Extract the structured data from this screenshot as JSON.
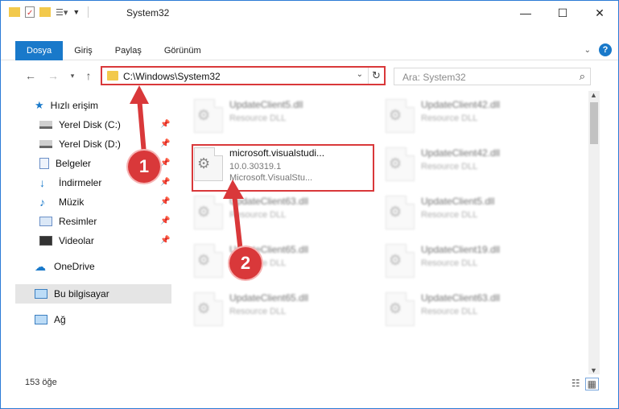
{
  "window": {
    "title": "System32",
    "controls": {
      "minimize": "—",
      "maximize": "☐",
      "close": "✕"
    }
  },
  "ribbon": {
    "tabs": [
      "Dosya",
      "Giriş",
      "Paylaş",
      "Görünüm"
    ],
    "active_tab": "Dosya",
    "help": "?"
  },
  "address": {
    "path": "C:\\Windows\\System32",
    "search_placeholder": "Ara: System32"
  },
  "nav": {
    "items": [
      {
        "label": "Hızlı erişim",
        "icon": "star-icon"
      },
      {
        "label": "Yerel Disk (C:)",
        "icon": "drive-icon",
        "pinned": true
      },
      {
        "label": "Yerel Disk (D:)",
        "icon": "drive-icon",
        "pinned": true
      },
      {
        "label": "Belgeler",
        "icon": "document-icon",
        "pinned": true
      },
      {
        "label": "İndirmeler",
        "icon": "download-icon",
        "pinned": true
      },
      {
        "label": "Müzik",
        "icon": "music-icon",
        "pinned": true
      },
      {
        "label": "Resimler",
        "icon": "pictures-icon",
        "pinned": true
      },
      {
        "label": "Videolar",
        "icon": "videos-icon",
        "pinned": true
      },
      {
        "label": "OneDrive",
        "icon": "cloud-icon"
      },
      {
        "label": "Bu bilgisayar",
        "icon": "computer-icon",
        "selected": true
      },
      {
        "label": "Ağ",
        "icon": "network-icon"
      }
    ]
  },
  "files": {
    "left": [
      {
        "name": "UpdateClient5.dll",
        "l1": "Resource DLL",
        "l2": ""
      },
      {
        "name": "microsoft.visualstudi...",
        "l1": "10.0.30319.1",
        "l2": "Microsoft.VisualStu..."
      },
      {
        "name": "UpdateClient63.dll",
        "l1": "Resource DLL",
        "l2": ""
      },
      {
        "name": "UpdateClient65.dll",
        "l1": "Resource DLL",
        "l2": ""
      },
      {
        "name": "UpdateClient65.dll",
        "l1": "Resource DLL",
        "l2": ""
      }
    ],
    "right": [
      {
        "name": "UpdateClient42.dll",
        "l1": "Resource DLL"
      },
      {
        "name": "UpdateClient42.dll",
        "l1": "Resource DLL"
      },
      {
        "name": "UpdateClient5.dll",
        "l1": "Resource DLL"
      },
      {
        "name": "UpdateClient19.dll",
        "l1": "Resource DLL"
      },
      {
        "name": "UpdateClient63.dll",
        "l1": "Resource DLL"
      }
    ]
  },
  "status": {
    "count": "153 öğe"
  },
  "annotations": {
    "callout1": "1",
    "callout2": "2"
  },
  "colors": {
    "accent": "#1979ca",
    "annotation": "#d9383a"
  }
}
